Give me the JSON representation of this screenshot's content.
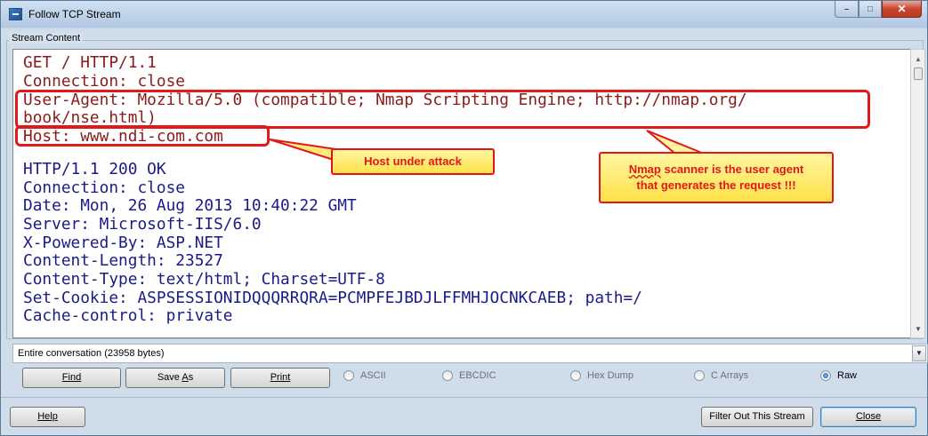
{
  "window": {
    "title": "Follow TCP Stream",
    "controls": {
      "minimize": "–",
      "maximize": "□",
      "close": "✕"
    }
  },
  "stream": {
    "group_label": "Stream Content",
    "request_lines": [
      "GET / HTTP/1.1",
      "Connection: close",
      "User-Agent: Mozilla/5.0 (compatible; Nmap Scripting Engine; http://nmap.org/",
      "book/nse.html)",
      "Host: www.ndi-com.com"
    ],
    "response_lines": [
      "HTTP/1.1 200 OK",
      "Connection: close",
      "Date: Mon, 26 Aug 2013 10:40:22 GMT",
      "Server: Microsoft-IIS/6.0",
      "X-Powered-By: ASP.NET",
      "Content-Length: 23527",
      "Content-Type: text/html; Charset=UTF-8",
      "Set-Cookie: ASPSESSIONIDQQQRRQRA=PCMPFEJBDJLFFMHJOCNKCAEB; path=/",
      "Cache-control: private"
    ],
    "request_color": "#8b1a1a",
    "response_color": "#1a1a8b"
  },
  "annotations": {
    "host_callout": "Host under attack",
    "agent_callout_word": "Nmap",
    "agent_callout_line1_rest": " scanner is the user agent",
    "agent_callout_line2": "that generates the request !!!",
    "highlight_color": "#e0191b"
  },
  "conversation": {
    "selected": "Entire conversation (23958 bytes)"
  },
  "buttons": {
    "find": "Find",
    "save_as_prefix": "Save ",
    "save_as_accel": "A",
    "save_as_suffix": "s",
    "print": "Print",
    "help": "Help",
    "filter_out": "Filter Out This Stream",
    "close": "Close"
  },
  "format_options": [
    {
      "label": "ASCII",
      "checked": false
    },
    {
      "label": "EBCDIC",
      "checked": false
    },
    {
      "label": "Hex Dump",
      "checked": false
    },
    {
      "label": "C Arrays",
      "checked": false
    },
    {
      "label": "Raw",
      "checked": true
    }
  ]
}
